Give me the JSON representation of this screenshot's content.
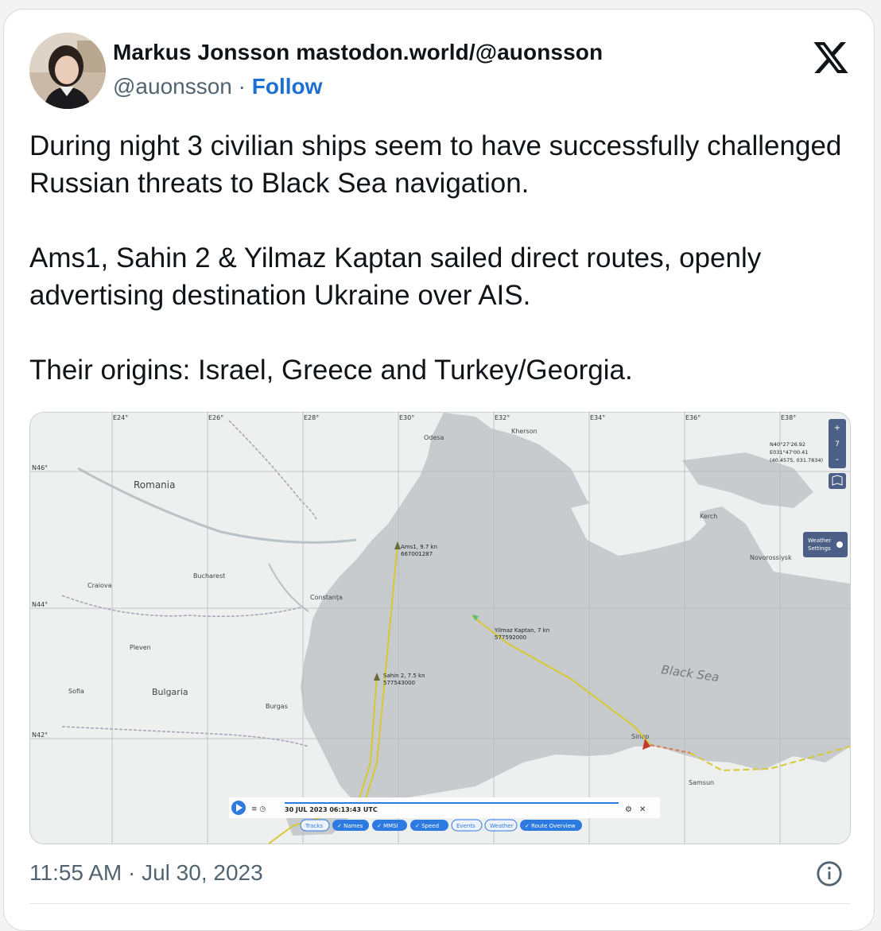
{
  "author": {
    "name": "Markus Jonsson mastodon.world/@auonsson",
    "handle": "@auonsson",
    "separator": "·",
    "follow_label": "Follow"
  },
  "tweet": {
    "paragraphs": [
      "During night 3 civilian ships seem to have successfully challenged Russian threats to Black Sea navigation.",
      "Ams1, Sahin 2 & Yilmaz Kaptan sailed direct routes, openly advertising destination Ukraine over AIS.",
      "Their origins: Israel, Greece and Turkey/Georgia."
    ],
    "timestamp": "11:55 AM · Jul 30, 2023"
  },
  "map": {
    "sea_label": "Black Sea",
    "places": {
      "romania": "Romania",
      "bulgaria": "Bulgaria",
      "odesa": "Odesa",
      "kherson": "Kherson",
      "bucharest": "Bucharest",
      "samsun": "Samsun",
      "burgas": "Burgas",
      "kerch": "Kerch",
      "sofia": "Sofia",
      "constanta": "Constanța",
      "sinop": "Sinop",
      "craiova": "Craiova",
      "pleven": "Pleven",
      "novorossiysk": "Novorossiysk"
    },
    "ships": [
      {
        "label": "Ams1, 9.7 kn",
        "mmsi": "667001287"
      },
      {
        "label": "Sahin 2, 7.5 kn",
        "mmsi": "577543000"
      },
      {
        "label": "Yilmaz Kaptan, 7 kn",
        "mmsi": "577592000"
      }
    ],
    "coords_readout": [
      "N40°27'26.92",
      "E031°47'00.41",
      "(40.4575, 031.7834)"
    ],
    "grid_longitudes": [
      "E24°",
      "E26°",
      "E28°",
      "E30°",
      "E32°",
      "E34°",
      "E36°",
      "E38°"
    ],
    "grid_latitudes": [
      "N46°",
      "N44°",
      "N42°"
    ],
    "playback": {
      "datetime": "30 JUL 2023 06:13:43 UTC",
      "chips": [
        "Tracks",
        "Names",
        "MMSI",
        "Speed",
        "Events",
        "Weather",
        "Route Overview"
      ],
      "checked": [
        "Names",
        "MMSI",
        "Speed",
        "Route Overview"
      ]
    },
    "zoom": {
      "in": "+",
      "level": "7",
      "out": "-"
    },
    "weather_settings": [
      "Weather",
      "Settings"
    ],
    "colors": {
      "track": "#d8c832",
      "sea": "#c7cbcd",
      "land": "#eeefef"
    }
  },
  "colors": {
    "accent": "#1d6fd3",
    "text": "#0f1419",
    "muted": "#536471"
  }
}
